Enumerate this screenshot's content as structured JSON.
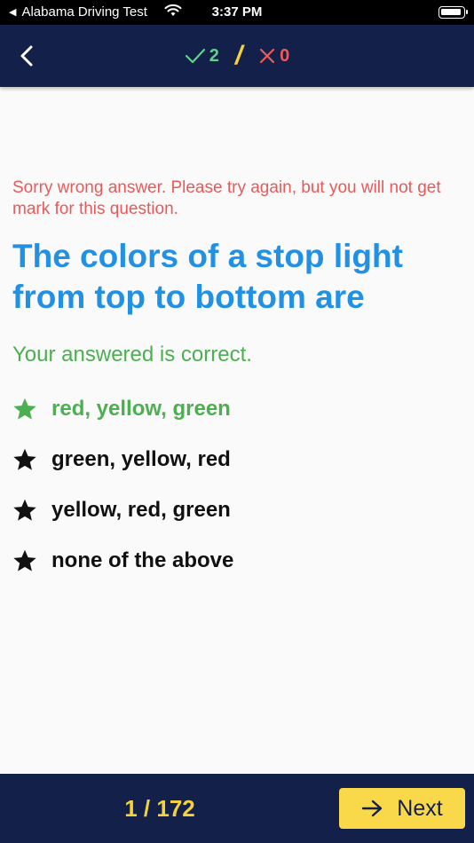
{
  "status_bar": {
    "back_app": "Alabama Driving Test",
    "time": "3:37 PM"
  },
  "header": {
    "correct_count": "2",
    "wrong_count": "0",
    "icons": {
      "back": "chevron-left-icon",
      "correct": "check-icon",
      "wrong": "x-icon"
    }
  },
  "question": {
    "wrong_message": "Sorry wrong answer. Please try again, but you will not get mark for this question.",
    "text": "The colors of a stop light from top to bottom are",
    "correct_message": "Your answered is correct.",
    "answers": [
      {
        "label": "red, yellow, green",
        "state": "correct"
      },
      {
        "label": "green, yellow, red",
        "state": "default"
      },
      {
        "label": "yellow, red, green",
        "state": "default"
      },
      {
        "label": "none of the above",
        "state": "default"
      }
    ]
  },
  "footer": {
    "progress": "1 / 172",
    "next_label": "Next"
  },
  "colors": {
    "navy": "#13204a",
    "accent_yellow": "#f5d23a",
    "correct_green": "#4caf50",
    "wrong_red": "#e85a5a",
    "question_blue": "#2291e3"
  }
}
